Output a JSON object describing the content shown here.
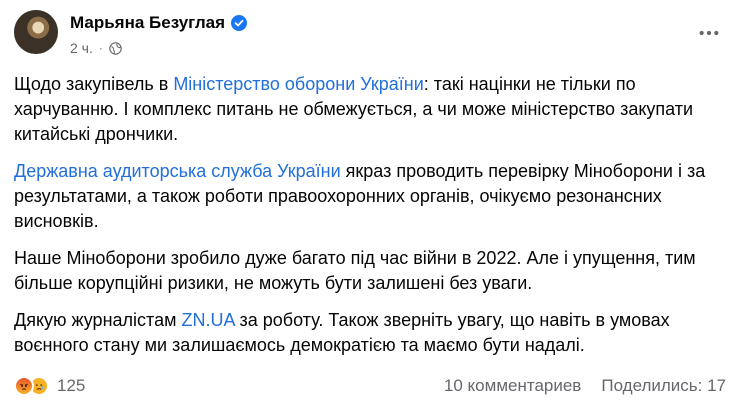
{
  "author": {
    "name": "Марьяна Безуглая"
  },
  "post_meta": {
    "time": "2 ч.",
    "separator": "·"
  },
  "post": {
    "p1": {
      "pre": "Щодо закупівель в ",
      "link": "Міністерство оборони України",
      "post": ": такі націнки не тільки по харчуванню. І комплекс питань не обмежується, а чи може міністерство закупати китайські дрончики."
    },
    "p2": {
      "link": "Державна аудиторська служба України",
      "post": " якраз проводить перевірку Міноборони і за результатами, а також роботи правоохоронних органів, очікуємо резонансних висновків."
    },
    "p3": "Наше Міноборони зробило дуже багато під час війни в 2022. Але і упущення, тим більше корупційні ризики, не можуть бути залишені без уваги.",
    "p4": {
      "pre": "Дякую журналістам ",
      "link": "ZN.UA",
      "post": " за роботу. Також зверніть увагу, що навіть в умовах воєнного стану ми залишаємось демократією та маємо бути надалі."
    }
  },
  "footer": {
    "reaction_count": "125",
    "comments": "10 комментариев",
    "shares": "Поделились: 17"
  },
  "icons": {
    "verified": "verified-badge-icon",
    "globe": "globe-icon",
    "more": "more-dots-icon",
    "react_angry": "angry-reaction-icon",
    "react_sad": "sad-reaction-icon"
  },
  "colors": {
    "link": "#216fdb",
    "verified": "#1877f2",
    "meta": "#65676b",
    "text": "#050505"
  }
}
